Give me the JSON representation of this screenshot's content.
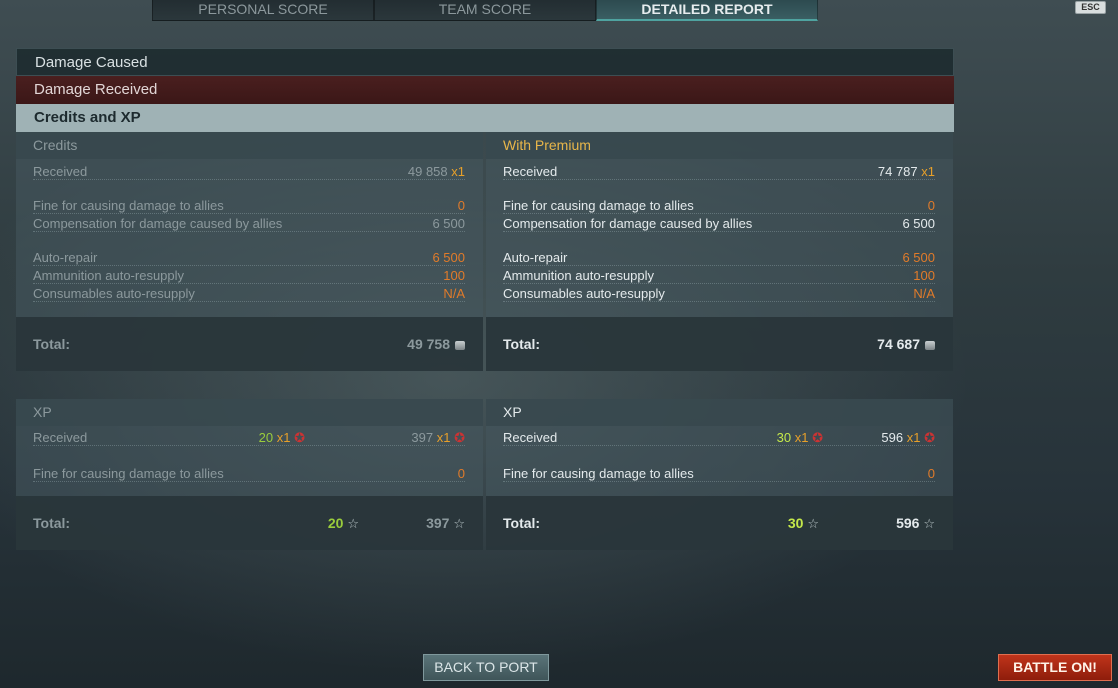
{
  "tabs": [
    {
      "label": "PERSONAL SCORE"
    },
    {
      "label": "TEAM SCORE"
    },
    {
      "label": "DETAILED REPORT"
    }
  ],
  "esc_label": "ESC",
  "sections": {
    "damage_caused": "Damage Caused",
    "damage_received": "Damage Received",
    "credits_xp": "Credits and XP"
  },
  "credits": {
    "standard": {
      "title": "Credits",
      "received_label": "Received",
      "received_value": "49 858",
      "received_mult": "x1",
      "fine_label": "Fine for causing damage to allies",
      "fine_value": "0",
      "comp_label": "Compensation for damage caused by allies",
      "comp_value": "6 500",
      "repair_label": "Auto-repair",
      "repair_value": "6 500",
      "ammo_label": "Ammunition auto-resupply",
      "ammo_value": "100",
      "consum_label": "Consumables auto-resupply",
      "consum_value": "N/A",
      "total_label": "Total:",
      "total_value": "49 758"
    },
    "premium": {
      "title": "With Premium",
      "received_label": "Received",
      "received_value": "74 787",
      "received_mult": "x1",
      "fine_label": "Fine for causing damage to allies",
      "fine_value": "0",
      "comp_label": "Compensation for damage caused by allies",
      "comp_value": "6 500",
      "repair_label": "Auto-repair",
      "repair_value": "6 500",
      "ammo_label": "Ammunition auto-resupply",
      "ammo_value": "100",
      "consum_label": "Consumables auto-resupply",
      "consum_value": "N/A",
      "total_label": "Total:",
      "total_value": "74 687"
    }
  },
  "xp": {
    "standard": {
      "title": "XP",
      "received_label": "Received",
      "received_a": "20",
      "received_a_mult": "x1",
      "received_b": "397",
      "received_b_mult": "x1",
      "fine_label": "Fine for causing damage to allies",
      "fine_value": "0",
      "total_label": "Total:",
      "total_a": "20",
      "total_b": "397"
    },
    "premium": {
      "title": "XP",
      "received_label": "Received",
      "received_a": "30",
      "received_a_mult": "x1",
      "received_b": "596",
      "received_b_mult": "x1",
      "fine_label": "Fine for causing damage to allies",
      "fine_value": "0",
      "total_label": "Total:",
      "total_a": "30",
      "total_b": "596"
    }
  },
  "buttons": {
    "back_to_port": "BACK TO PORT",
    "battle_on": "BATTLE ON!"
  },
  "icons": {
    "credit": "credit-coin-icon",
    "elite_xp": "elite-xp-star-icon",
    "xp_star": "xp-star-icon"
  },
  "colors": {
    "penalty": "#e07b2a",
    "premium_title": "#e8b64a",
    "xp_green": "#9acd3c",
    "battle_button": "#c0341b"
  }
}
